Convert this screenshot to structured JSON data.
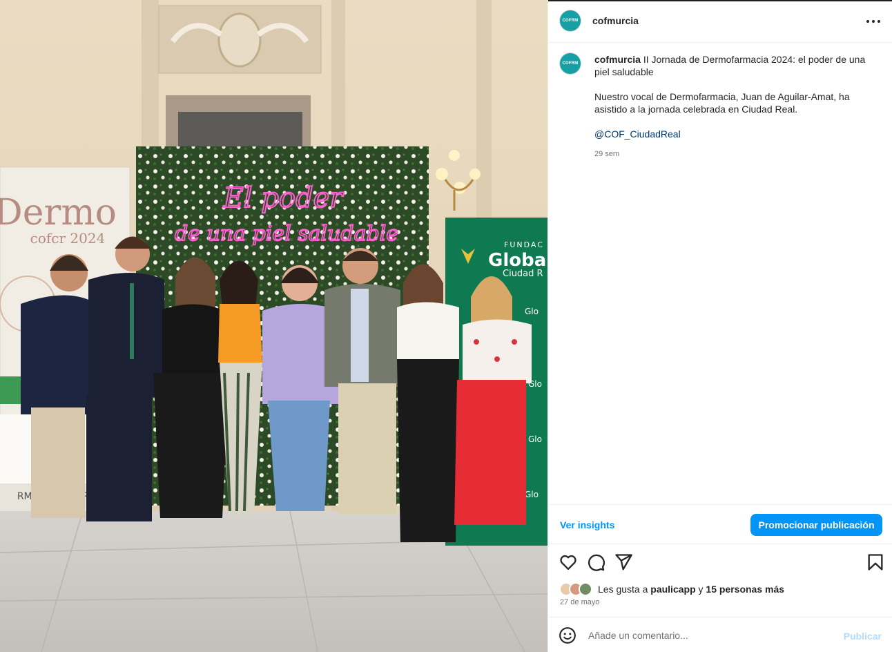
{
  "post": {
    "account_name": "cofmurcia",
    "avatar_text": "COFRM",
    "caption_title": "II Jornada de Dermofarmacia 2024: el poder de una piel saludable",
    "caption_body": "Nuestro vocal de Dermofarmacia, Juan de Aguilar-Amat, ha asistido a la jornada celebrada en Ciudad Real.",
    "caption_mention": "@COF_CiudadReal",
    "caption_time": "29 sem",
    "insights_label": "Ver insights",
    "promote_label": "Promocionar publicación",
    "likes_prefix": "Les gusta a ",
    "likes_user": "paulicapp",
    "likes_middle": " y ",
    "likes_others": "15 personas más",
    "date": "27 de mayo",
    "comment_placeholder": "Añade un comentario...",
    "publish_label": "Publicar"
  },
  "photo": {
    "neon_line1": "El poder",
    "neon_line2": "de una piel saludable",
    "banner_left_title": "Dermo",
    "banner_left_sub": "cofcr 2024",
    "banner_left_bottom": "RMACIA   DAD REAL",
    "banner_right_top": "FUNDAC",
    "banner_right_brand": "Global",
    "banner_right_city": "Ciudad R"
  },
  "icons": [
    "more-icon",
    "heart-icon",
    "comment-icon",
    "share-icon",
    "bookmark-icon",
    "emoji-icon"
  ],
  "colors": {
    "accent": "#0095f6",
    "brand_teal": "#16a0a6",
    "neon_pink": "#ff5fd0",
    "banner_green": "#0f7a52"
  }
}
